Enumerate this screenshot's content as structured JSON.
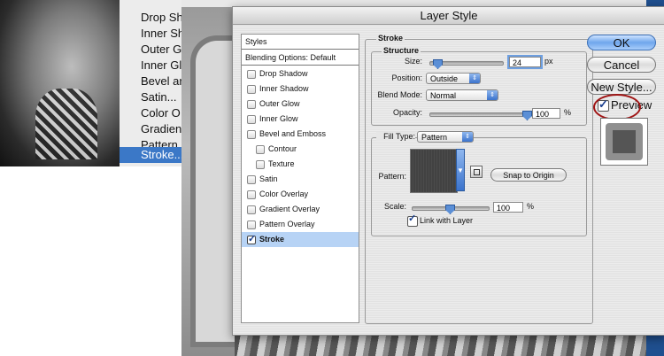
{
  "background_menu": {
    "items": [
      "Drop Sh",
      "Inner Sh",
      "Outer G",
      "Inner Gl",
      "Bevel ar",
      "Satin...",
      "Color O",
      "Gradien",
      "Pattern",
      "Stroke..."
    ],
    "selected_index": 9
  },
  "dialog": {
    "title": "Layer Style",
    "styles_list": {
      "header": "Styles",
      "blending": "Blending Options: Default",
      "items": [
        {
          "label": "Drop Shadow",
          "checked": false,
          "indent": false
        },
        {
          "label": "Inner Shadow",
          "checked": false,
          "indent": false
        },
        {
          "label": "Outer Glow",
          "checked": false,
          "indent": false
        },
        {
          "label": "Inner Glow",
          "checked": false,
          "indent": false
        },
        {
          "label": "Bevel and Emboss",
          "checked": false,
          "indent": false
        },
        {
          "label": "Contour",
          "checked": false,
          "indent": true
        },
        {
          "label": "Texture",
          "checked": false,
          "indent": true
        },
        {
          "label": "Satin",
          "checked": false,
          "indent": false
        },
        {
          "label": "Color Overlay",
          "checked": false,
          "indent": false
        },
        {
          "label": "Gradient Overlay",
          "checked": false,
          "indent": false
        },
        {
          "label": "Pattern Overlay",
          "checked": false,
          "indent": false
        },
        {
          "label": "Stroke",
          "checked": true,
          "indent": false,
          "selected": true
        }
      ]
    },
    "stroke": {
      "group_title": "Stroke",
      "structure_title": "Structure",
      "size_label": "Size:",
      "size_value": "24",
      "size_unit": "px",
      "position_label": "Position:",
      "position_value": "Outside",
      "blend_mode_label": "Blend Mode:",
      "blend_mode_value": "Normal",
      "opacity_label": "Opacity:",
      "opacity_value": "100",
      "opacity_unit": "%",
      "fill_type_label": "Fill Type:",
      "fill_type_value": "Pattern",
      "pattern_label": "Pattern:",
      "snap_button": "Snap to Origin",
      "scale_label": "Scale:",
      "scale_value": "100",
      "scale_unit": "%",
      "link_label": "Link with Layer",
      "link_checked": true
    },
    "buttons": {
      "ok": "OK",
      "cancel": "Cancel",
      "new_style": "New Style...",
      "preview": "Preview",
      "preview_checked": true
    },
    "accent_color": "#3b78c7",
    "annotation_color": "#a01515"
  }
}
